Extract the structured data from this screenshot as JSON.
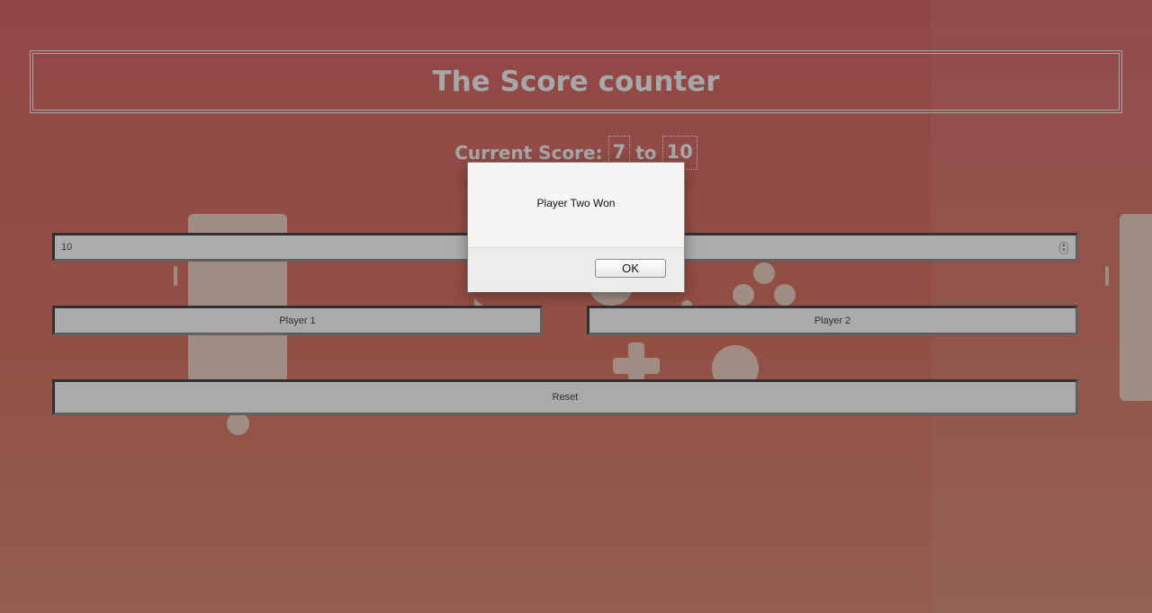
{
  "page": {
    "title": "The Score counter",
    "score_label": "Current Score:",
    "player_one_score": "7",
    "score_separator": "to",
    "player_two_score": "10"
  },
  "controls": {
    "winning_score_value": "10",
    "player1_button": "Player 1",
    "player2_button": "Player 2",
    "reset_button": "Reset"
  },
  "dialog": {
    "message": "Player Two Won",
    "ok_button": "OK"
  },
  "colors": {
    "background": "#c84040",
    "text": "#eeeeee"
  }
}
